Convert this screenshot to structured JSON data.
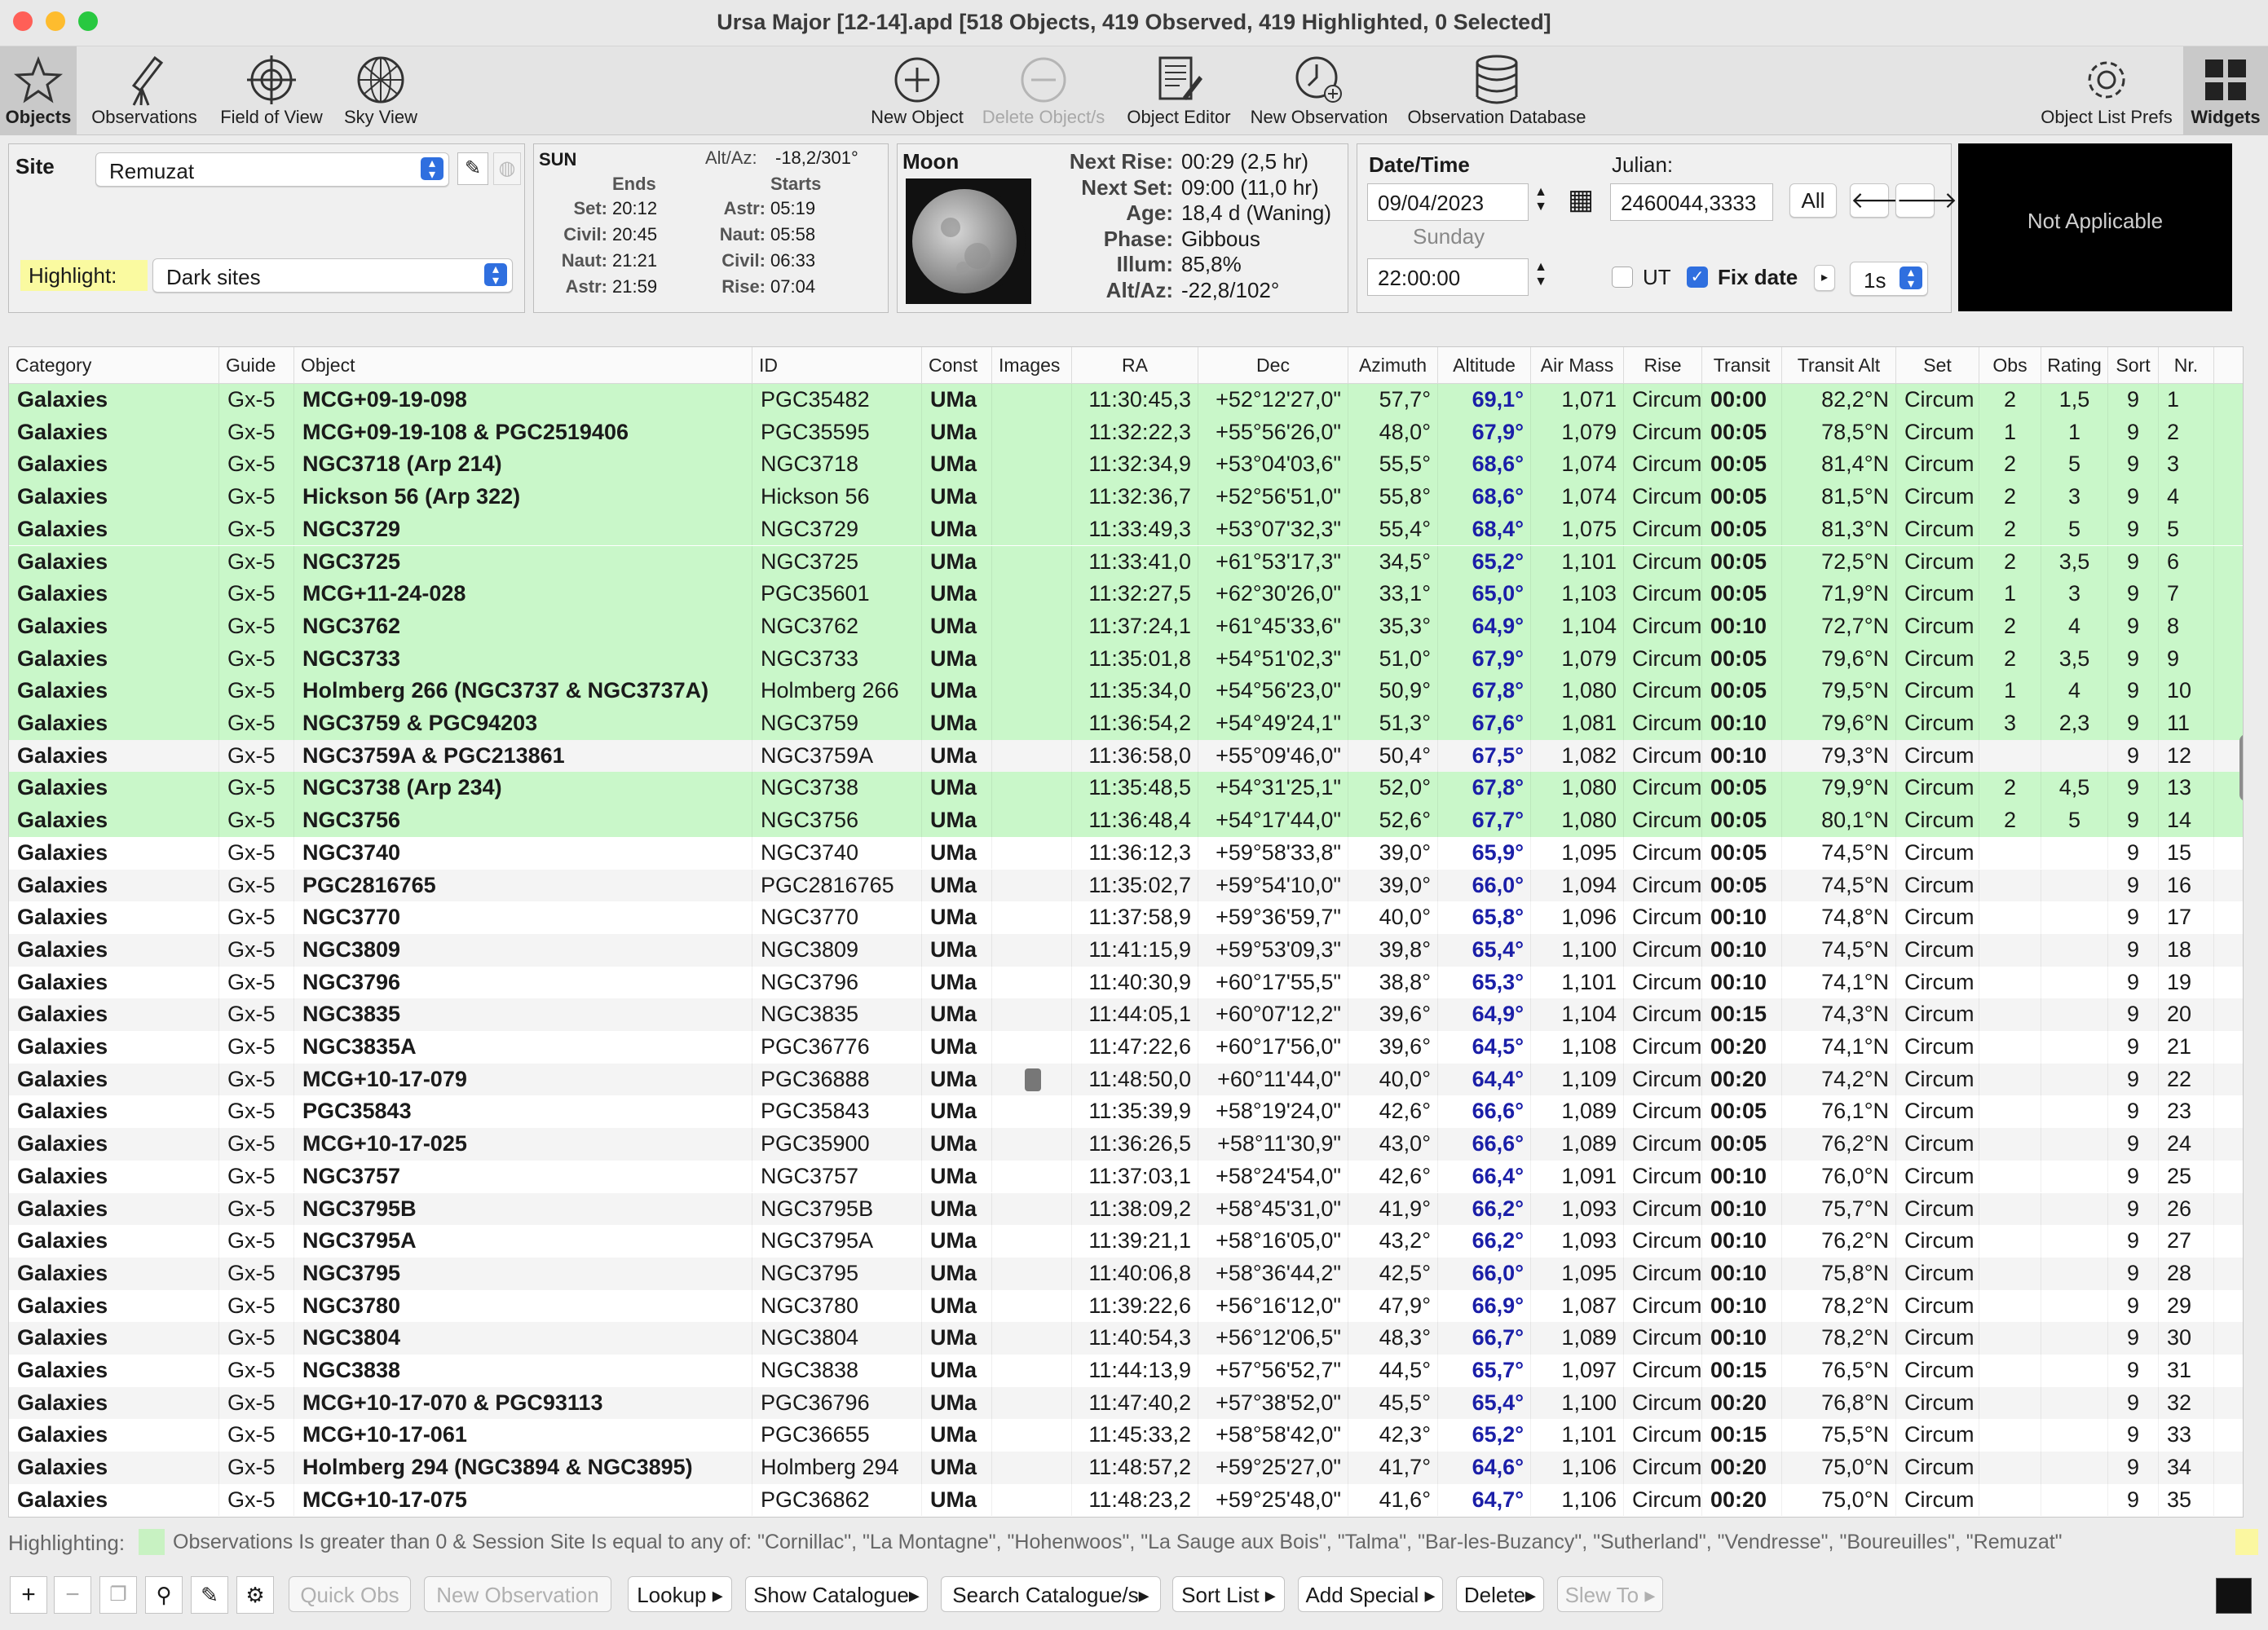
{
  "window": {
    "title": "Ursa Major [12-14].apd [518 Objects, 419 Observed, 419 Highlighted, 0 Selected]"
  },
  "toolbar": {
    "objects": "Objects",
    "observations": "Observations",
    "field_of_view": "Field of View",
    "sky_view": "Sky View",
    "new_object": "New Object",
    "delete_objects": "Delete Object/s",
    "object_editor": "Object Editor",
    "new_observation": "New Observation",
    "observation_database": "Observation Database",
    "object_list_prefs": "Object List Prefs",
    "widgets": "Widgets"
  },
  "site": {
    "label": "Site",
    "value": "Remuzat",
    "highlight_label": "Highlight:",
    "highlight_value": "Dark sites"
  },
  "sun": {
    "title": "SUN",
    "altaz_label": "Alt/Az:",
    "altaz": "-18,2/301°",
    "ends": "Ends",
    "starts": "Starts",
    "left": [
      {
        "k": "Set:",
        "v": "20:12"
      },
      {
        "k": "Civil:",
        "v": "20:45"
      },
      {
        "k": "Naut:",
        "v": "21:21"
      },
      {
        "k": "Astr:",
        "v": "21:59"
      }
    ],
    "right": [
      {
        "k": "Astr:",
        "v": "05:19"
      },
      {
        "k": "Naut:",
        "v": "05:58"
      },
      {
        "k": "Civil:",
        "v": "06:33"
      },
      {
        "k": "Rise:",
        "v": "07:04"
      }
    ]
  },
  "moon": {
    "title": "Moon",
    "rows": [
      {
        "k": "Next Rise:",
        "v": "00:29 (2,5 hr)"
      },
      {
        "k": "Next Set:",
        "v": "09:00 (11,0 hr)"
      },
      {
        "k": "Age:",
        "v": "18,4 d (Waning)"
      },
      {
        "k": "Phase:",
        "v": "Gibbous"
      },
      {
        "k": "Illum:",
        "v": "85,8%"
      },
      {
        "k": "Alt/Az:",
        "v": "-22,8/102°"
      }
    ]
  },
  "datetime": {
    "title": "Date/Time",
    "date": "09/04/2023",
    "weekday": "Sunday",
    "time": "22:00:00",
    "julian_label": "Julian:",
    "julian": "2460044,3333",
    "all": "All",
    "ut": "UT",
    "fixdate": "Fix date",
    "step": "1s"
  },
  "widget": {
    "text": "Not Applicable"
  },
  "table": {
    "headers": [
      "Category",
      "Guide",
      "Object",
      "ID",
      "Const",
      "Images",
      "RA",
      "Dec",
      "Azimuth",
      "Altitude",
      "Air Mass",
      "Rise",
      "Transit",
      "Transit Alt",
      "Set",
      "Obs",
      "Rating",
      "Sort",
      "Nr."
    ],
    "rows": [
      {
        "hl": true,
        "c": [
          "Galaxies",
          "Gx-5",
          "MCG+09-19-098",
          "PGC35482",
          "UMa",
          "",
          "11:30:45,3",
          "+52°12'27,0\"",
          "57,7°",
          "69,1°",
          "1,071",
          "Circum",
          "00:00",
          "82,2°N",
          "Circum",
          "2",
          "1,5",
          "9",
          "1"
        ]
      },
      {
        "hl": true,
        "c": [
          "Galaxies",
          "Gx-5",
          "MCG+09-19-108 & PGC2519406",
          "PGC35595",
          "UMa",
          "",
          "11:32:22,3",
          "+55°56'26,0\"",
          "48,0°",
          "67,9°",
          "1,079",
          "Circum",
          "00:05",
          "78,5°N",
          "Circum",
          "1",
          "1",
          "9",
          "2"
        ]
      },
      {
        "hl": true,
        "c": [
          "Galaxies",
          "Gx-5",
          "NGC3718 (Arp 214)",
          "NGC3718",
          "UMa",
          "",
          "11:32:34,9",
          "+53°04'03,6\"",
          "55,5°",
          "68,6°",
          "1,074",
          "Circum",
          "00:05",
          "81,4°N",
          "Circum",
          "2",
          "5",
          "9",
          "3"
        ]
      },
      {
        "hl": true,
        "c": [
          "Galaxies",
          "Gx-5",
          "Hickson 56 (Arp 322)",
          "Hickson 56",
          "UMa",
          "",
          "11:32:36,7",
          "+52°56'51,0\"",
          "55,8°",
          "68,6°",
          "1,074",
          "Circum",
          "00:05",
          "81,5°N",
          "Circum",
          "2",
          "3",
          "9",
          "4"
        ]
      },
      {
        "hl": true,
        "c": [
          "Galaxies",
          "Gx-5",
          "NGC3729",
          "NGC3729",
          "UMa",
          "",
          "11:33:49,3",
          "+53°07'32,3\"",
          "55,4°",
          "68,4°",
          "1,075",
          "Circum",
          "00:05",
          "81,3°N",
          "Circum",
          "2",
          "5",
          "9",
          "5"
        ]
      },
      {
        "hl": true,
        "c": [
          "Galaxies",
          "Gx-5",
          "NGC3725",
          "NGC3725",
          "UMa",
          "",
          "11:33:41,0",
          "+61°53'17,3\"",
          "34,5°",
          "65,2°",
          "1,101",
          "Circum",
          "00:05",
          "72,5°N",
          "Circum",
          "2",
          "3,5",
          "9",
          "6"
        ]
      },
      {
        "hl": true,
        "c": [
          "Galaxies",
          "Gx-5",
          "MCG+11-24-028",
          "PGC35601",
          "UMa",
          "",
          "11:32:27,5",
          "+62°30'26,0\"",
          "33,1°",
          "65,0°",
          "1,103",
          "Circum",
          "00:05",
          "71,9°N",
          "Circum",
          "1",
          "3",
          "9",
          "7"
        ]
      },
      {
        "hl": true,
        "c": [
          "Galaxies",
          "Gx-5",
          "NGC3762",
          "NGC3762",
          "UMa",
          "",
          "11:37:24,1",
          "+61°45'33,6\"",
          "35,3°",
          "64,9°",
          "1,104",
          "Circum",
          "00:10",
          "72,7°N",
          "Circum",
          "2",
          "4",
          "9",
          "8"
        ]
      },
      {
        "hl": true,
        "c": [
          "Galaxies",
          "Gx-5",
          "NGC3733",
          "NGC3733",
          "UMa",
          "",
          "11:35:01,8",
          "+54°51'02,3\"",
          "51,0°",
          "67,9°",
          "1,079",
          "Circum",
          "00:05",
          "79,6°N",
          "Circum",
          "2",
          "3,5",
          "9",
          "9"
        ]
      },
      {
        "hl": true,
        "c": [
          "Galaxies",
          "Gx-5",
          "Holmberg 266 (NGC3737 & NGC3737A)",
          "Holmberg 266",
          "UMa",
          "",
          "11:35:34,0",
          "+54°56'23,0\"",
          "50,9°",
          "67,8°",
          "1,080",
          "Circum",
          "00:05",
          "79,5°N",
          "Circum",
          "1",
          "4",
          "9",
          "10"
        ]
      },
      {
        "hl": true,
        "c": [
          "Galaxies",
          "Gx-5",
          "NGC3759 & PGC94203",
          "NGC3759",
          "UMa",
          "",
          "11:36:54,2",
          "+54°49'24,1\"",
          "51,3°",
          "67,6°",
          "1,081",
          "Circum",
          "00:10",
          "79,6°N",
          "Circum",
          "3",
          "2,3",
          "9",
          "11"
        ]
      },
      {
        "hl": false,
        "c": [
          "Galaxies",
          "Gx-5",
          "NGC3759A & PGC213861",
          "NGC3759A",
          "UMa",
          "",
          "11:36:58,0",
          "+55°09'46,0\"",
          "50,4°",
          "67,5°",
          "1,082",
          "Circum",
          "00:10",
          "79,3°N",
          "Circum",
          "",
          "",
          "9",
          "12"
        ]
      },
      {
        "hl": true,
        "c": [
          "Galaxies",
          "Gx-5",
          "NGC3738 (Arp 234)",
          "NGC3738",
          "UMa",
          "",
          "11:35:48,5",
          "+54°31'25,1\"",
          "52,0°",
          "67,8°",
          "1,080",
          "Circum",
          "00:05",
          "79,9°N",
          "Circum",
          "2",
          "4,5",
          "9",
          "13"
        ]
      },
      {
        "hl": true,
        "c": [
          "Galaxies",
          "Gx-5",
          "NGC3756",
          "NGC3756",
          "UMa",
          "",
          "11:36:48,4",
          "+54°17'44,0\"",
          "52,6°",
          "67,7°",
          "1,080",
          "Circum",
          "00:05",
          "80,1°N",
          "Circum",
          "2",
          "5",
          "9",
          "14"
        ]
      },
      {
        "hl": false,
        "c": [
          "Galaxies",
          "Gx-5",
          "NGC3740",
          "NGC3740",
          "UMa",
          "",
          "11:36:12,3",
          "+59°58'33,8\"",
          "39,0°",
          "65,9°",
          "1,095",
          "Circum",
          "00:05",
          "74,5°N",
          "Circum",
          "",
          "",
          "9",
          "15"
        ]
      },
      {
        "hl": false,
        "c": [
          "Galaxies",
          "Gx-5",
          "PGC2816765",
          "PGC2816765",
          "UMa",
          "",
          "11:35:02,7",
          "+59°54'10,0\"",
          "39,0°",
          "66,0°",
          "1,094",
          "Circum",
          "00:05",
          "74,5°N",
          "Circum",
          "",
          "",
          "9",
          "16"
        ]
      },
      {
        "hl": false,
        "c": [
          "Galaxies",
          "Gx-5",
          "NGC3770",
          "NGC3770",
          "UMa",
          "",
          "11:37:58,9",
          "+59°36'59,7\"",
          "40,0°",
          "65,8°",
          "1,096",
          "Circum",
          "00:10",
          "74,8°N",
          "Circum",
          "",
          "",
          "9",
          "17"
        ]
      },
      {
        "hl": false,
        "c": [
          "Galaxies",
          "Gx-5",
          "NGC3809",
          "NGC3809",
          "UMa",
          "",
          "11:41:15,9",
          "+59°53'09,3\"",
          "39,8°",
          "65,4°",
          "1,100",
          "Circum",
          "00:10",
          "74,5°N",
          "Circum",
          "",
          "",
          "9",
          "18"
        ]
      },
      {
        "hl": false,
        "c": [
          "Galaxies",
          "Gx-5",
          "NGC3796",
          "NGC3796",
          "UMa",
          "",
          "11:40:30,9",
          "+60°17'55,5\"",
          "38,8°",
          "65,3°",
          "1,101",
          "Circum",
          "00:10",
          "74,1°N",
          "Circum",
          "",
          "",
          "9",
          "19"
        ]
      },
      {
        "hl": false,
        "c": [
          "Galaxies",
          "Gx-5",
          "NGC3835",
          "NGC3835",
          "UMa",
          "",
          "11:44:05,1",
          "+60°07'12,2\"",
          "39,6°",
          "64,9°",
          "1,104",
          "Circum",
          "00:15",
          "74,3°N",
          "Circum",
          "",
          "",
          "9",
          "20"
        ]
      },
      {
        "hl": false,
        "c": [
          "Galaxies",
          "Gx-5",
          "NGC3835A",
          "PGC36776",
          "UMa",
          "",
          "11:47:22,6",
          "+60°17'56,0\"",
          "39,6°",
          "64,5°",
          "1,108",
          "Circum",
          "00:20",
          "74,1°N",
          "Circum",
          "",
          "",
          "9",
          "21"
        ]
      },
      {
        "hl": false,
        "img": true,
        "c": [
          "Galaxies",
          "Gx-5",
          "MCG+10-17-079",
          "PGC36888",
          "UMa",
          "",
          "11:48:50,0",
          "+60°11'44,0\"",
          "40,0°",
          "64,4°",
          "1,109",
          "Circum",
          "00:20",
          "74,2°N",
          "Circum",
          "",
          "",
          "9",
          "22"
        ]
      },
      {
        "hl": false,
        "c": [
          "Galaxies",
          "Gx-5",
          "PGC35843",
          "PGC35843",
          "UMa",
          "",
          "11:35:39,9",
          "+58°19'24,0\"",
          "42,6°",
          "66,6°",
          "1,089",
          "Circum",
          "00:05",
          "76,1°N",
          "Circum",
          "",
          "",
          "9",
          "23"
        ]
      },
      {
        "hl": false,
        "c": [
          "Galaxies",
          "Gx-5",
          "MCG+10-17-025",
          "PGC35900",
          "UMa",
          "",
          "11:36:26,5",
          "+58°11'30,9\"",
          "43,0°",
          "66,6°",
          "1,089",
          "Circum",
          "00:05",
          "76,2°N",
          "Circum",
          "",
          "",
          "9",
          "24"
        ]
      },
      {
        "hl": false,
        "c": [
          "Galaxies",
          "Gx-5",
          "NGC3757",
          "NGC3757",
          "UMa",
          "",
          "11:37:03,1",
          "+58°24'54,0\"",
          "42,6°",
          "66,4°",
          "1,091",
          "Circum",
          "00:10",
          "76,0°N",
          "Circum",
          "",
          "",
          "9",
          "25"
        ]
      },
      {
        "hl": false,
        "c": [
          "Galaxies",
          "Gx-5",
          "NGC3795B",
          "NGC3795B",
          "UMa",
          "",
          "11:38:09,2",
          "+58°45'31,0\"",
          "41,9°",
          "66,2°",
          "1,093",
          "Circum",
          "00:10",
          "75,7°N",
          "Circum",
          "",
          "",
          "9",
          "26"
        ]
      },
      {
        "hl": false,
        "c": [
          "Galaxies",
          "Gx-5",
          "NGC3795A",
          "NGC3795A",
          "UMa",
          "",
          "11:39:21,1",
          "+58°16'05,0\"",
          "43,2°",
          "66,2°",
          "1,093",
          "Circum",
          "00:10",
          "76,2°N",
          "Circum",
          "",
          "",
          "9",
          "27"
        ]
      },
      {
        "hl": false,
        "c": [
          "Galaxies",
          "Gx-5",
          "NGC3795",
          "NGC3795",
          "UMa",
          "",
          "11:40:06,8",
          "+58°36'44,2\"",
          "42,5°",
          "66,0°",
          "1,095",
          "Circum",
          "00:10",
          "75,8°N",
          "Circum",
          "",
          "",
          "9",
          "28"
        ]
      },
      {
        "hl": false,
        "c": [
          "Galaxies",
          "Gx-5",
          "NGC3780",
          "NGC3780",
          "UMa",
          "",
          "11:39:22,6",
          "+56°16'12,0\"",
          "47,9°",
          "66,9°",
          "1,087",
          "Circum",
          "00:10",
          "78,2°N",
          "Circum",
          "",
          "",
          "9",
          "29"
        ]
      },
      {
        "hl": false,
        "c": [
          "Galaxies",
          "Gx-5",
          "NGC3804",
          "NGC3804",
          "UMa",
          "",
          "11:40:54,3",
          "+56°12'06,5\"",
          "48,3°",
          "66,7°",
          "1,089",
          "Circum",
          "00:10",
          "78,2°N",
          "Circum",
          "",
          "",
          "9",
          "30"
        ]
      },
      {
        "hl": false,
        "c": [
          "Galaxies",
          "Gx-5",
          "NGC3838",
          "NGC3838",
          "UMa",
          "",
          "11:44:13,9",
          "+57°56'52,7\"",
          "44,5°",
          "65,7°",
          "1,097",
          "Circum",
          "00:15",
          "76,5°N",
          "Circum",
          "",
          "",
          "9",
          "31"
        ]
      },
      {
        "hl": false,
        "c": [
          "Galaxies",
          "Gx-5",
          "MCG+10-17-070 & PGC93113",
          "PGC36796",
          "UMa",
          "",
          "11:47:40,2",
          "+57°38'52,0\"",
          "45,5°",
          "65,4°",
          "1,100",
          "Circum",
          "00:20",
          "76,8°N",
          "Circum",
          "",
          "",
          "9",
          "32"
        ]
      },
      {
        "hl": false,
        "c": [
          "Galaxies",
          "Gx-5",
          "MCG+10-17-061",
          "PGC36655",
          "UMa",
          "",
          "11:45:33,2",
          "+58°58'42,0\"",
          "42,3°",
          "65,2°",
          "1,101",
          "Circum",
          "00:15",
          "75,5°N",
          "Circum",
          "",
          "",
          "9",
          "33"
        ]
      },
      {
        "hl": false,
        "c": [
          "Galaxies",
          "Gx-5",
          "Holmberg 294 (NGC3894 & NGC3895)",
          "Holmberg 294",
          "UMa",
          "",
          "11:48:57,2",
          "+59°25'27,0\"",
          "41,7°",
          "64,6°",
          "1,106",
          "Circum",
          "00:20",
          "75,0°N",
          "Circum",
          "",
          "",
          "9",
          "34"
        ]
      },
      {
        "hl": false,
        "c": [
          "Galaxies",
          "Gx-5",
          "MCG+10-17-075",
          "PGC36862",
          "UMa",
          "",
          "11:48:23,2",
          "+59°25'48,0\"",
          "41,6°",
          "64,7°",
          "1,106",
          "Circum",
          "00:20",
          "75,0°N",
          "Circum",
          "",
          "",
          "9",
          "35"
        ]
      }
    ]
  },
  "highlighting": {
    "label": "Highlighting:",
    "text": "Observations Is greater than 0 & Session Site Is equal to any of: \"Cornillac\", \"La Montagne\", \"Hohenwoos\", \"La Sauge aux Bois\", \"Talma\", \"Bar-les-Buzancy\", \"Sutherland\", \"Vendresse\", \"Boureuilles\", \"Remuzat\""
  },
  "bottom": {
    "quick_obs": "Quick Obs",
    "new_observation": "New Observation",
    "lookup": "Lookup",
    "show_catalogue": "Show Catalogue",
    "search_catalogue": "Search Catalogue/s",
    "sort_list": "Sort List",
    "add_special": "Add Special",
    "delete": "Delete",
    "slew_to": "Slew To"
  },
  "colors": {
    "highlight_row": "#c9f7c9",
    "altitude_text": "#1b1fa8",
    "highlight_swatch_1": "#c8f2c2",
    "highlight_swatch_2": "#fbf7a0"
  }
}
